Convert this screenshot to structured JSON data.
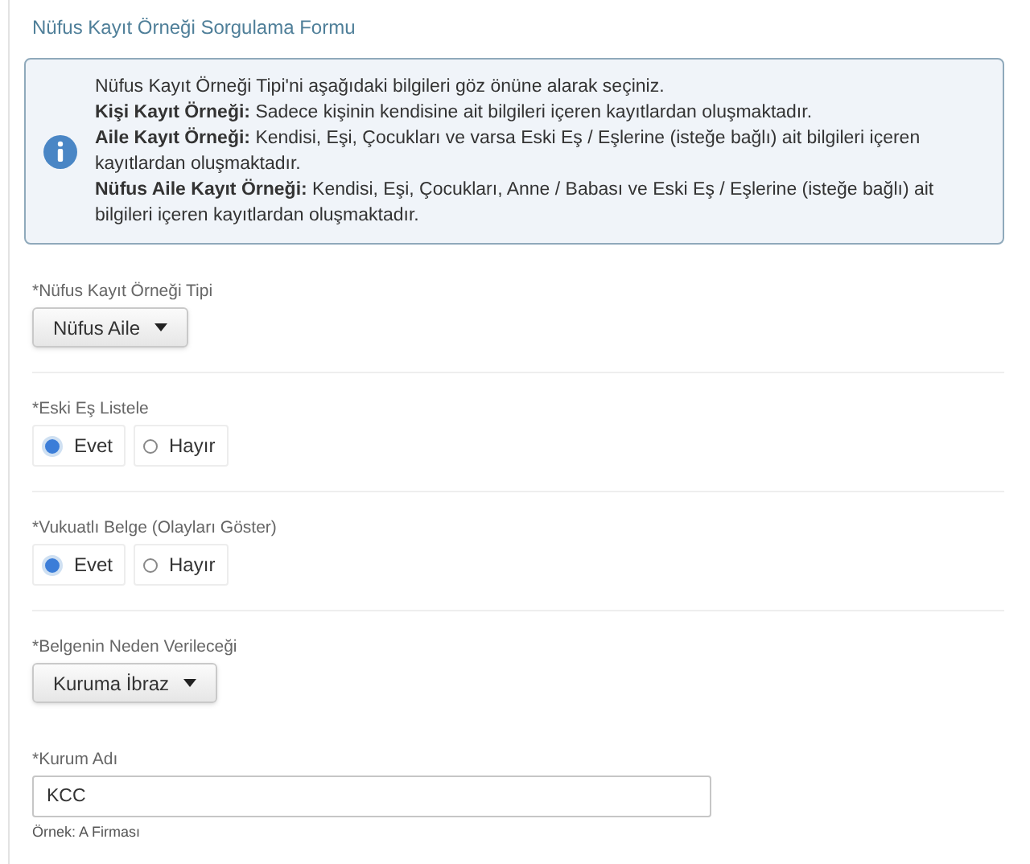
{
  "form_title": "Nüfus Kayıt Örneği Sorgulama Formu",
  "info": {
    "paragraphs": [
      "Nüfus Kayıt Örneği Tipi'ni aşağıdaki bilgileri göz önüne alarak seçiniz.",
      "**Kişi Kayıt Örneği:** Sadece kişinin kendisine ait bilgileri içeren kayıtlardan oluşmaktadır.",
      "**Aile Kayıt Örneği:** Kendisi, Eşi, Çocukları ve varsa Eski Eş / Eşlerine (isteğe bağlı) ait bilgileri içeren kayıtlardan oluşmaktadır.",
      "**Nüfus Aile Kayıt Örneği:** Kendisi, Eşi, Çocukları, Anne / Babası ve Eski Eş / Eşlerine (isteğe bağlı) ait bilgileri içeren kayıtlardan oluşmaktadır."
    ]
  },
  "sections": [
    [
      {
        "kind": "select",
        "label": "*Nüfus Kayıt Örneği Tipi",
        "value": "Nüfus Aile"
      }
    ],
    [
      {
        "kind": "radio",
        "label": "*Eski Eş Listele",
        "options": [
          {
            "label": "Evet",
            "selected": true
          },
          {
            "label": "Hayır",
            "selected": false
          }
        ]
      }
    ],
    [
      {
        "kind": "radio",
        "label": "*Vukuatlı Belge (Olayları Göster)",
        "options": [
          {
            "label": "Evet",
            "selected": true
          },
          {
            "label": "Hayır",
            "selected": false
          }
        ]
      }
    ],
    [
      {
        "kind": "select",
        "label": "*Belgenin Neden Verileceği",
        "value": "Kuruma İbraz"
      },
      {
        "kind": "text",
        "label": "*Kurum Adı",
        "value": "KCC",
        "hint": "Örnek: A Firması"
      }
    ]
  ]
}
